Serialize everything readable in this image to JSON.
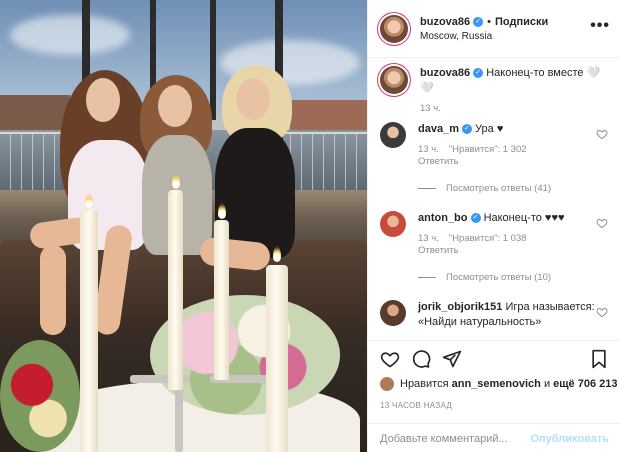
{
  "post": {
    "username": "buzova86",
    "follow_label": "Подписки",
    "location": "Moscow, Russia",
    "caption": "Наконец-то вместе 🤍🤍",
    "caption_age": "13 ч."
  },
  "comments": [
    {
      "username": "dava_m",
      "text": "Ура ♥",
      "age": "13 ч.",
      "likes": "\"Нравится\": 1 302",
      "reply": "Ответить",
      "view_replies": "Посмотреть ответы (41)"
    },
    {
      "username": "anton_bo",
      "text": "Наконец-то ♥♥♥",
      "age": "13 ч.",
      "likes": "\"Нравится\": 1 038",
      "reply": "Ответить",
      "view_replies": "Посмотреть ответы (10)"
    },
    {
      "username": "jorik_objorik151",
      "text": "Игра называется: «Найди натуральность»"
    }
  ],
  "likes": {
    "prefix": "Нравится",
    "user": "ann_semenovich",
    "middle": "и",
    "others": "ещё 706 213"
  },
  "timestamp": "13 ЧАСОВ НАЗАД",
  "comment_box": {
    "placeholder": "Добавьте комментарий...",
    "post_label": "Опубликовать"
  },
  "icons": {
    "like": "heart-icon",
    "comment": "comment-icon",
    "share": "share-icon",
    "save": "bookmark-icon",
    "more": "more-icon"
  },
  "colors": {
    "verified": "#3897f0",
    "post_button": "#b2dffc",
    "muted": "#8e8e8e"
  }
}
